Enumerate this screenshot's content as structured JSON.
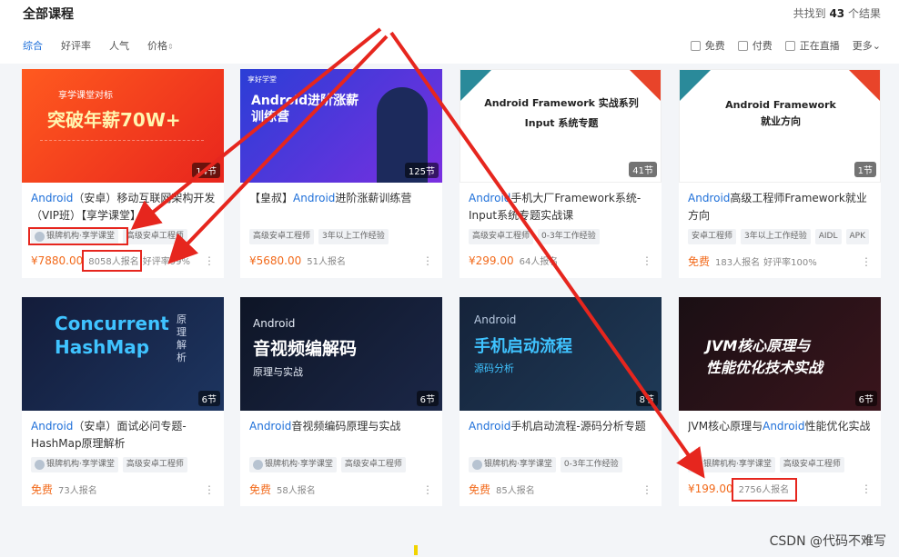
{
  "header": {
    "title": "全部课程",
    "result_prefix": "共找到",
    "result_count": "43",
    "result_suffix": "个结果"
  },
  "sorts": [
    "综合",
    "好评率",
    "人气",
    "价格"
  ],
  "filters": {
    "free": "免费",
    "paid": "付费",
    "live": "正在直播",
    "more": "更多"
  },
  "courses": [
    {
      "thumb_title": "突破年薪70W+",
      "thumb_sub": "享学课堂对标",
      "count": "14节",
      "name_hl": "Android",
      "name_rest": "（安卓）移动互联网架构开发（VIP班）【享学课堂】",
      "tags": [
        "银牌机构·享学课堂",
        "高级安卓工程师"
      ],
      "price": "¥7880.00",
      "enroll": "8058人报名",
      "rating": "好评率99%"
    },
    {
      "thumb_title": "Android进阶涨薪训练营",
      "thumb_sub": "享好学堂",
      "count": "125节",
      "name_pre": "【皇叔】",
      "name_hl": "Android",
      "name_rest": "进阶涨薪训练营",
      "tags": [
        "高级安卓工程师",
        "3年以上工作经验"
      ],
      "price": "¥5680.00",
      "enroll": "51人报名",
      "rating": ""
    },
    {
      "thumb_title": "Android Framework 实战系列",
      "thumb_sub": "Input 系统专题",
      "count": "41节",
      "name_hl": "Android",
      "name_rest": "手机大厂Framework系统-Input系统专题实战课",
      "tags": [
        "高级安卓工程师",
        "0-3年工作经验"
      ],
      "price": "¥299.00",
      "enroll": "64人报名",
      "rating": ""
    },
    {
      "thumb_title": "Android Framework",
      "thumb_sub": "就业方向",
      "count": "1节",
      "name_hl": "Android",
      "name_rest": "高级工程师Framework就业方向",
      "tags": [
        "安卓工程师",
        "3年以上工作经验",
        "AIDL",
        "APK"
      ],
      "price": "免费",
      "enroll": "183人报名",
      "rating": "好评率100%"
    },
    {
      "thumb_title": "Concurrent HashMap",
      "thumb_sub": "原理解析",
      "count": "6节",
      "name_hl": "Android",
      "name_rest": "（安卓）面试必问专题-HashMap原理解析",
      "tags": [
        "银牌机构·享学课堂",
        "高级安卓工程师"
      ],
      "price": "免费",
      "enroll": "73人报名",
      "rating": ""
    },
    {
      "thumb_title": "音视频编解码",
      "thumb_sub": "原理与实战",
      "count": "6节",
      "name_hl": "Android",
      "name_rest": "音视频编码原理与实战",
      "tags": [
        "银牌机构·享学课堂",
        "高级安卓工程师"
      ],
      "price": "免费",
      "enroll": "58人报名",
      "rating": ""
    },
    {
      "thumb_title": "手机启动流程",
      "thumb_sub": "源码分析",
      "count": "8节",
      "name_hl": "Android",
      "name_rest": "手机启动流程-源码分析专题",
      "tags": [
        "银牌机构·享学课堂",
        "0-3年工作经验"
      ],
      "price": "免费",
      "enroll": "85人报名",
      "rating": ""
    },
    {
      "thumb_title": "JVM核心原理与",
      "thumb_sub": "性能优化技术实战",
      "count": "6节",
      "name_pre": "JVM核心原理与",
      "name_hl": "Android",
      "name_rest": "性能优化实战",
      "tags": [
        "银牌机构·享学课堂",
        "高级安卓工程师"
      ],
      "price": "¥199.00",
      "enroll": "2756人报名",
      "rating": ""
    }
  ],
  "watermark": "CSDN @代码不难写",
  "colors": {
    "accent": "#1e6fd9",
    "price": "#f26a1b",
    "annotation": "#e6261e"
  }
}
